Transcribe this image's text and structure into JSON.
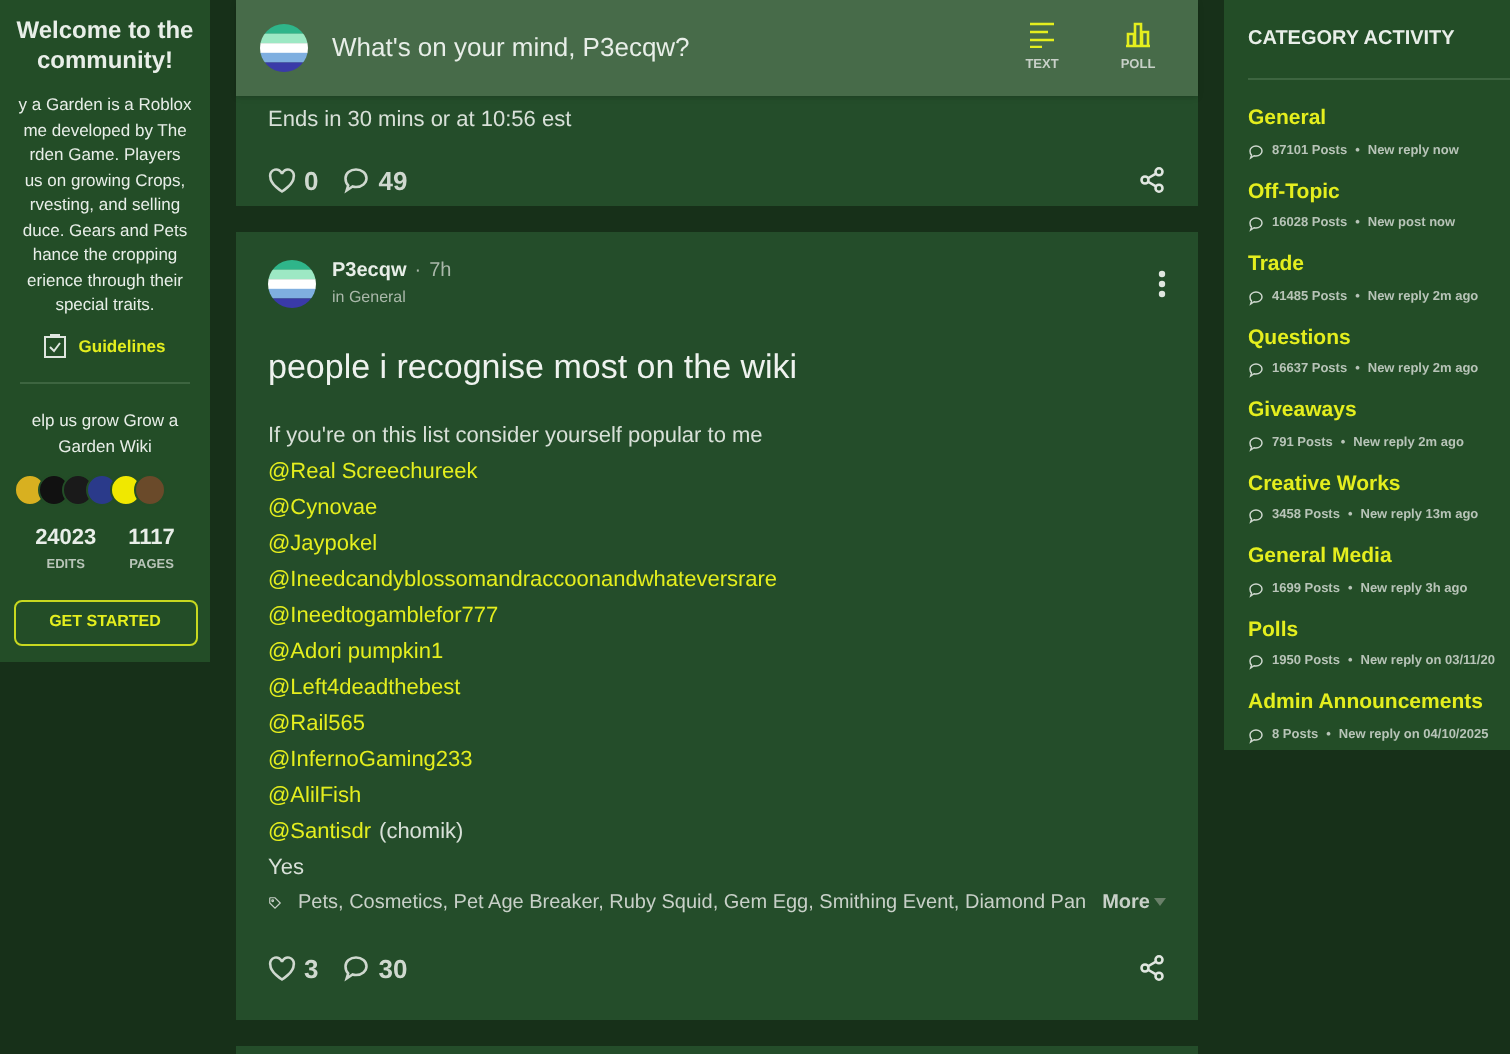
{
  "welcome": {
    "title_lines": [
      "Welcome to the",
      "community!"
    ],
    "description_lines": [
      "y a Garden is a Roblox",
      "me developed by The",
      "rden Game. Players",
      "us on growing Crops,",
      "rvesting, and selling",
      "duce. Gears and Pets",
      "hance the cropping",
      "erience through their",
      "special traits."
    ],
    "guidelines_link": "Guidelines",
    "help_lines": [
      "elp us grow Grow a",
      "Garden Wiki"
    ],
    "stats": [
      {
        "value": "24023",
        "label": "EDITS"
      },
      {
        "value": "1117",
        "label": "PAGES"
      }
    ],
    "button": "GET STARTED"
  },
  "composer": {
    "placeholder": "What's on your mind, P3ecqw?",
    "actions": [
      {
        "kind": "text",
        "label": "TEXT"
      },
      {
        "kind": "poll",
        "label": "POLL"
      }
    ]
  },
  "previous_post": {
    "body": "Ends in 30 mins or at 10:56 est",
    "likes": "0",
    "comments": "49"
  },
  "post": {
    "author": "P3ecqw",
    "time_separator": "·",
    "time": "7h",
    "category": "in General",
    "title": "people i recognise most on the wiki",
    "body": [
      {
        "kind": "text",
        "text": "If you're on this list consider yourself popular to me"
      },
      {
        "kind": "mention",
        "text": "@Real Screechureek"
      },
      {
        "kind": "mention",
        "text": "@Cynovae"
      },
      {
        "kind": "mention",
        "text": "@Jaypokel"
      },
      {
        "kind": "mention",
        "text": "@Ineedcandyblossomandraccoonandwhateversrare"
      },
      {
        "kind": "mention",
        "text": "@Ineedtogamblefor777"
      },
      {
        "kind": "mention",
        "text": "@Adori pumpkin1"
      },
      {
        "kind": "mention",
        "text": "@Left4deadthebest"
      },
      {
        "kind": "mention",
        "text": "@Rail565"
      },
      {
        "kind": "mention",
        "text": "@InfernoGaming233"
      },
      {
        "kind": "mention",
        "text": "@AlilFish"
      },
      {
        "kind": "mention",
        "text": "@Santisdr",
        "suffix": "(chomik)"
      },
      {
        "kind": "text",
        "text": "Yes"
      }
    ],
    "tags": "Pets, Cosmetics, Pet Age Breaker, Ruby Squid, Gem Egg, Smithing Event, Diamond Pan",
    "more": "More",
    "likes": "3",
    "comments": "30"
  },
  "category_activity": {
    "title": "CATEGORY ACTIVITY",
    "separator": "•",
    "items": [
      {
        "name": "General",
        "posts": "87101 Posts",
        "activity": "New reply now"
      },
      {
        "name": "Off-Topic",
        "posts": "16028 Posts",
        "activity": "New post now"
      },
      {
        "name": "Trade",
        "posts": "41485 Posts",
        "activity": "New reply 2m ago"
      },
      {
        "name": "Questions",
        "posts": "16637 Posts",
        "activity": "New reply 2m ago"
      },
      {
        "name": "Giveaways",
        "posts": "791 Posts",
        "activity": "New reply 2m ago"
      },
      {
        "name": "Creative Works",
        "posts": "3458 Posts",
        "activity": "New reply 13m ago"
      },
      {
        "name": "General Media",
        "posts": "1699 Posts",
        "activity": "New reply 3h ago"
      },
      {
        "name": "Polls",
        "posts": "1950 Posts",
        "activity": "New reply on 03/11/20"
      },
      {
        "name": "Admin Announcements",
        "posts": "8 Posts",
        "activity": "New reply on 04/10/2025"
      }
    ]
  }
}
